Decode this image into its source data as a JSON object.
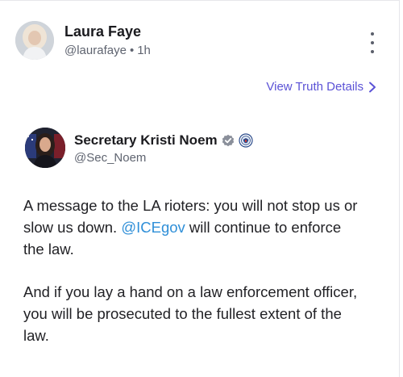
{
  "post": {
    "author_name": "Laura Faye",
    "author_handle": "@laurafaye",
    "separator": "•",
    "time": "1h",
    "view_details_label": "View Truth Details"
  },
  "quoted": {
    "author_name": "Secretary Kristi Noem",
    "author_handle": "@Sec_Noem",
    "paragraph1_before": "A message to the LA rioters: you will not stop us or slow us down. ",
    "mention": "@ICEgov",
    "paragraph1_after": " will continue to enforce the law.",
    "paragraph2": "And if you lay a hand on a law enforcement officer, you will be prosecuted to the fullest extent of the law."
  },
  "icons": {
    "more": "more-vertical-icon",
    "chevron": "chevron-right-icon",
    "verified": "verified-badge-icon",
    "seal": "dhs-seal-icon"
  },
  "colors": {
    "link": "#5b52d6",
    "mention": "#2f8fd8",
    "verified": "#8a8f9a"
  }
}
